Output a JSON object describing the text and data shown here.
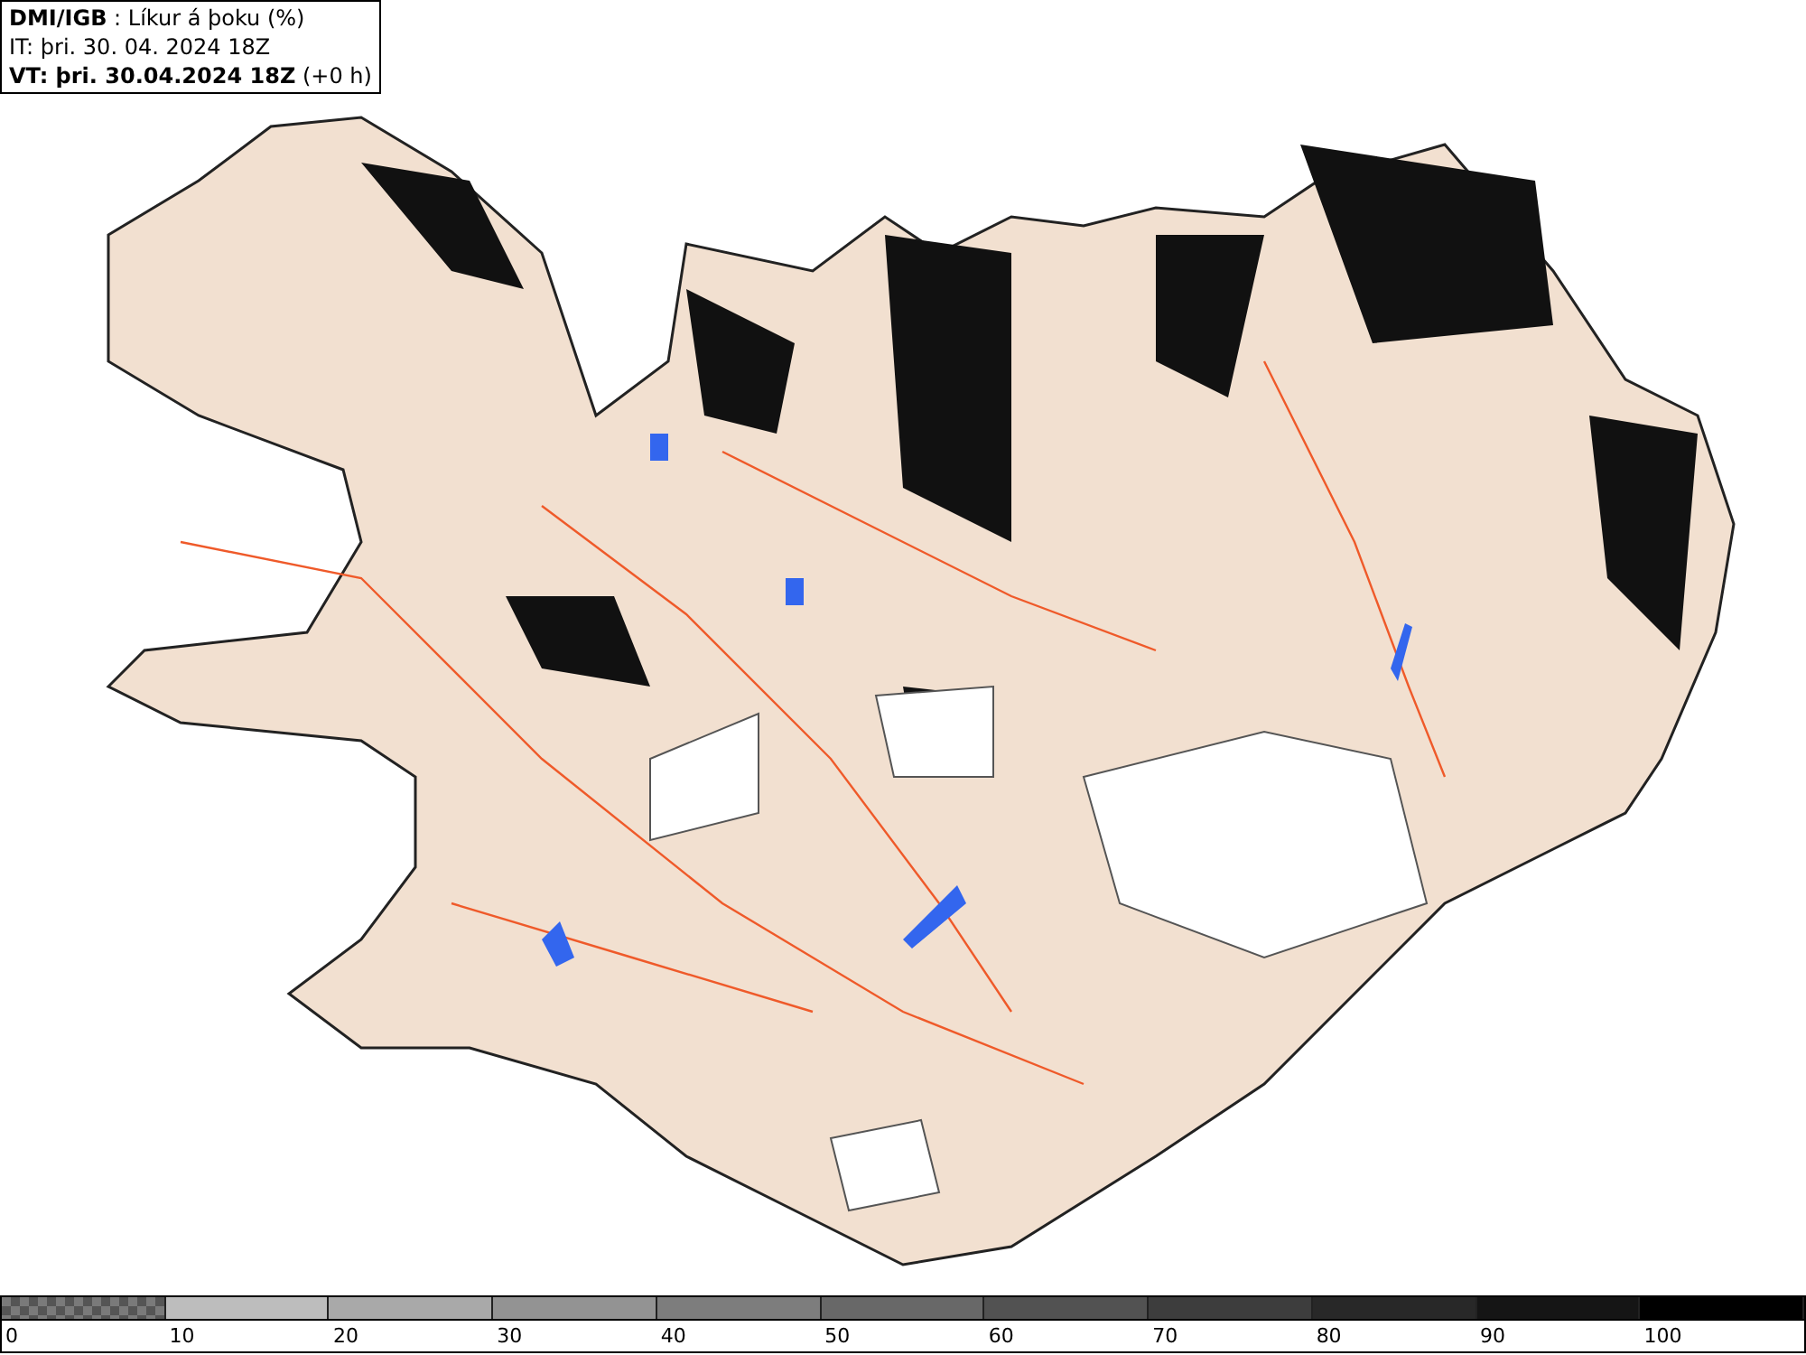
{
  "header": {
    "lines": [
      "**DMI/IGB** : Líkur á þoku (%)",
      "IT: þri. 30. 04. 2024 18Z",
      "**VT: þri. 30.04.2024 18Z** (+0 h)"
    ]
  },
  "legend": {
    "segments": [
      {
        "kind": "pattern",
        "color": "#7a7a7a"
      },
      {
        "kind": "solid",
        "color": "#bdbdbd"
      },
      {
        "kind": "solid",
        "color": "#a9a9a9"
      },
      {
        "kind": "solid",
        "color": "#939393"
      },
      {
        "kind": "solid",
        "color": "#7d7d7d"
      },
      {
        "kind": "solid",
        "color": "#686868"
      },
      {
        "kind": "solid",
        "color": "#525252"
      },
      {
        "kind": "solid",
        "color": "#3d3d3d"
      },
      {
        "kind": "solid",
        "color": "#282828"
      },
      {
        "kind": "solid",
        "color": "#151515"
      },
      {
        "kind": "solid",
        "color": "#000000"
      }
    ],
    "labels": [
      "0",
      "10",
      "20",
      "30",
      "40",
      "50",
      "60",
      "70",
      "80",
      "90",
      "100"
    ]
  }
}
